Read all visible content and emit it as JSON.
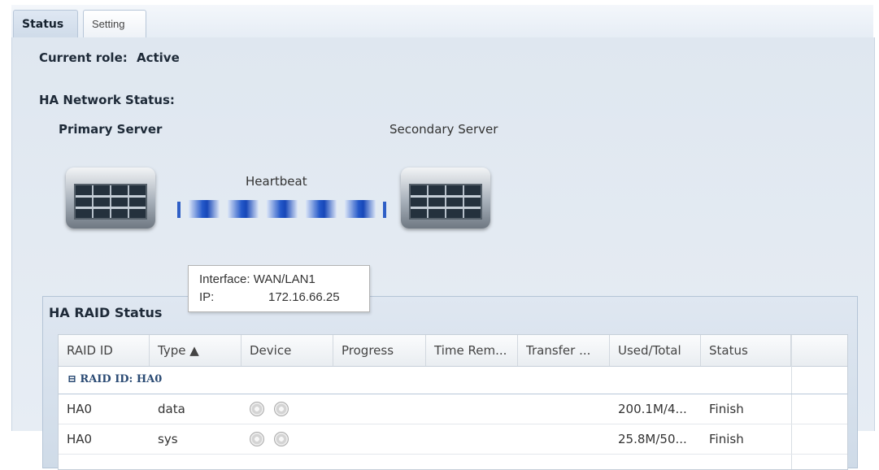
{
  "tabs": [
    {
      "label": "Status",
      "active": true
    },
    {
      "label": "Setting",
      "active": false
    }
  ],
  "status": {
    "current_role_label": "Current role:",
    "current_role_value": "Active",
    "ha_network_title": "HA Network Status:",
    "primary_label": "Primary Server",
    "secondary_label": "Secondary Server",
    "heartbeat_label": "Heartbeat",
    "tooltip": {
      "interface_label": "Interface:",
      "interface_value": "WAN/LAN1",
      "ip_label": "IP:",
      "ip_value": "172.16.66.25"
    }
  },
  "raid": {
    "title": "HA RAID Status",
    "columns": [
      "RAID ID",
      "Type ▲",
      "Device",
      "Progress",
      "Time Rem...",
      "Transfer ...",
      "Used/Total",
      "Status"
    ],
    "group_label": "⊟ RAID ID: HA0",
    "rows": [
      {
        "raid_id": "HA0",
        "type": "data",
        "progress": "",
        "time_remaining": "",
        "transfer": "",
        "used_total": "200.1M/4...",
        "status": "Finish"
      },
      {
        "raid_id": "HA0",
        "type": "sys",
        "progress": "",
        "time_remaining": "",
        "transfer": "",
        "used_total": "25.8M/50...",
        "status": "Finish"
      }
    ]
  },
  "icons": [
    "server-icon",
    "disk-icon",
    "collapse-icon",
    "sort-ascending-icon"
  ],
  "colors": {
    "accent": "#2458c9",
    "panel": "#e1e8f1"
  }
}
